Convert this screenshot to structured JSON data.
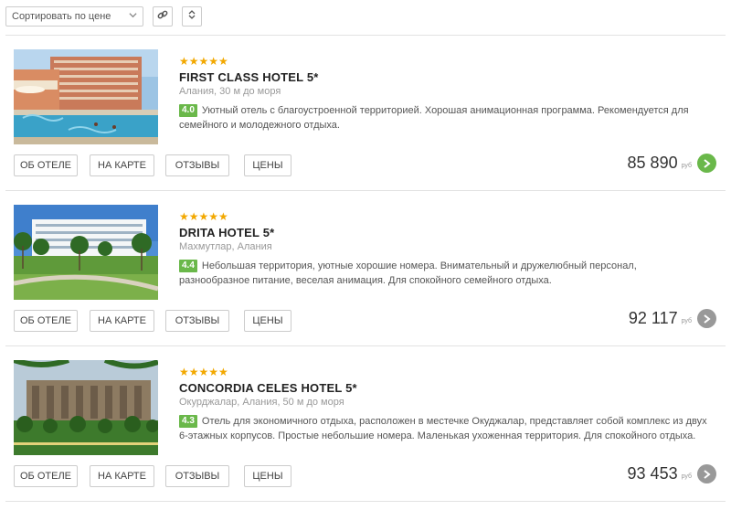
{
  "toolbar": {
    "sort_label": "Сортировать по цене",
    "sort_icon": "chevron-down-icon",
    "link_icon": "link-icon",
    "sort_order_icon": "sort-icon"
  },
  "colors": {
    "stars": "#f2a800",
    "rating_badge": "#6ab84a",
    "go_active": "#6ab84a",
    "go_inactive": "#999999"
  },
  "hotels": [
    {
      "stars": "★★★★★",
      "name": "FIRST CLASS HOTEL 5*",
      "location": "Алания, 30 м до моря",
      "rating": "4.0",
      "description": "Уютный отель с благоустроенной территорией. Хорошая анимационная программа. Рекомендуется для семейного и молодежного отдыха.",
      "btn_about": "ОБ ОТЕЛЕ",
      "btn_map": "НА КАРТЕ",
      "btn_reviews": "ОТЗЫВЫ",
      "btn_prices": "ЦЕНЫ",
      "price": "85 890",
      "currency": "руб",
      "go_state": "active"
    },
    {
      "stars": "★★★★★",
      "name": "DRITA HOTEL 5*",
      "location": "Махмутлар, Алания",
      "rating": "4.4",
      "description": "Небольшая территория, уютные хорошие номера. Внимательный и дружелюбный персонал, разнообразное питание, веселая анимация. Для спокойного семейного отдыха.",
      "btn_about": "ОБ ОТЕЛЕ",
      "btn_map": "НА КАРТЕ",
      "btn_reviews": "ОТЗЫВЫ",
      "btn_prices": "ЦЕНЫ",
      "price": "92 117",
      "currency": "руб",
      "go_state": "inactive"
    },
    {
      "stars": "★★★★★",
      "name": "CONCORDIA CELES HOTEL 5*",
      "location": "Окурджалар, Алания, 50 м до моря",
      "rating": "4.3",
      "description": "Отель для экономичного отдыха, расположен в местечке Окуджалар, представляет собой комплекс из двух 6-этажных корпусов. Простые небольшие номера. Маленькая ухоженная территория. Для спокойного отдыха.",
      "btn_about": "ОБ ОТЕЛЕ",
      "btn_map": "НА КАРТЕ",
      "btn_reviews": "ОТЗЫВЫ",
      "btn_prices": "ЦЕНЫ",
      "price": "93 453",
      "currency": "руб",
      "go_state": "inactive"
    }
  ]
}
